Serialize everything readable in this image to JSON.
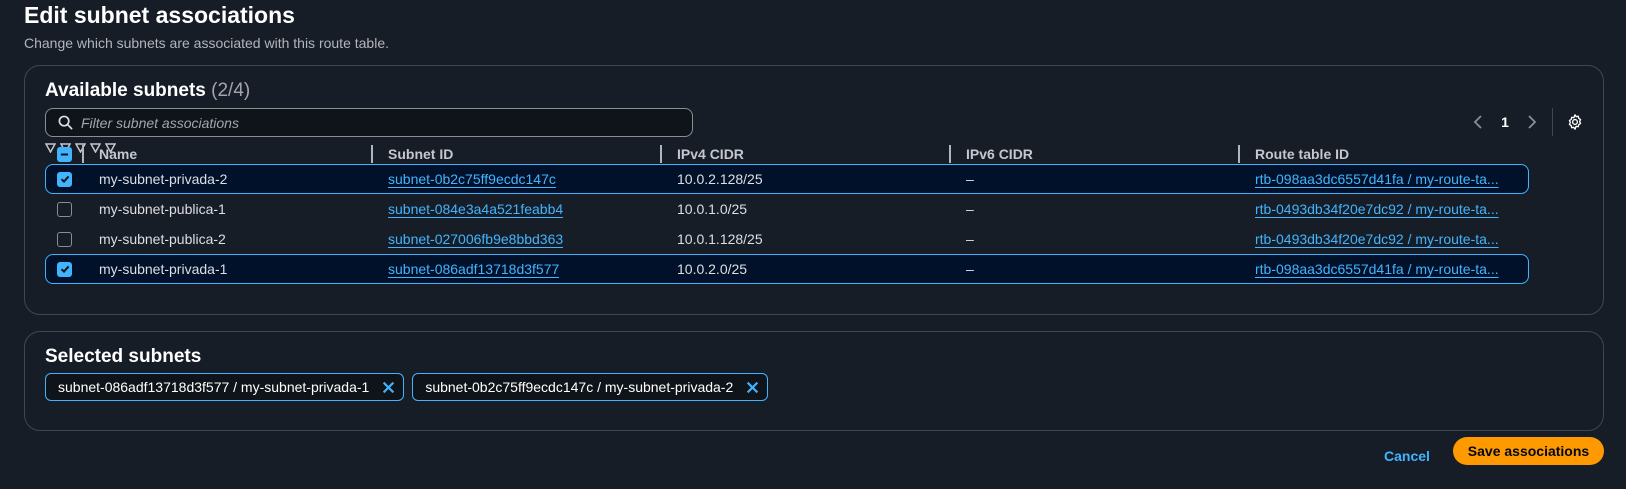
{
  "page": {
    "title": "Edit subnet associations",
    "description": "Change which subnets are associated with this route table."
  },
  "available": {
    "title": "Available subnets",
    "count": "(2/4)",
    "filter_placeholder": "Filter subnet associations",
    "page_number": "1",
    "columns": [
      "Name",
      "Subnet ID",
      "IPv4 CIDR",
      "IPv6 CIDR",
      "Route table ID"
    ],
    "rows": [
      {
        "selected": true,
        "name": "my-subnet-privada-2",
        "subnet_id": "subnet-0b2c75ff9ecdc147c",
        "ipv4": "10.0.2.128/25",
        "ipv6": "–",
        "route_table": "rtb-098aa3dc6557d41fa / my-route-ta..."
      },
      {
        "selected": false,
        "name": "my-subnet-publica-1",
        "subnet_id": "subnet-084e3a4a521feabb4",
        "ipv4": "10.0.1.0/25",
        "ipv6": "–",
        "route_table": "rtb-0493db34f20e7dc92 / my-route-ta..."
      },
      {
        "selected": false,
        "name": "my-subnet-publica-2",
        "subnet_id": "subnet-027006fb9e8bbd363",
        "ipv4": "10.0.1.128/25",
        "ipv6": "–",
        "route_table": "rtb-0493db34f20e7dc92 / my-route-ta..."
      },
      {
        "selected": true,
        "name": "my-subnet-privada-1",
        "subnet_id": "subnet-086adf13718d3f577",
        "ipv4": "10.0.2.0/25",
        "ipv6": "–",
        "route_table": "rtb-098aa3dc6557d41fa / my-route-ta..."
      }
    ]
  },
  "selected": {
    "title": "Selected subnets",
    "chips": [
      "subnet-086adf13718d3f577 / my-subnet-privada-1",
      "subnet-0b2c75ff9ecdc147c / my-subnet-privada-2"
    ]
  },
  "actions": {
    "cancel_label": "Cancel",
    "save_label": "Save associations"
  },
  "colors": {
    "background": "#161d26",
    "accent": "#42b4ff",
    "primary_button": "#ff9900",
    "selected_row": "#001129"
  },
  "icons": [
    "search-icon",
    "chevron-left-icon",
    "chevron-right-icon",
    "gear-icon",
    "sort-icon",
    "close-icon",
    "checkmark-icon",
    "minus-icon"
  ]
}
